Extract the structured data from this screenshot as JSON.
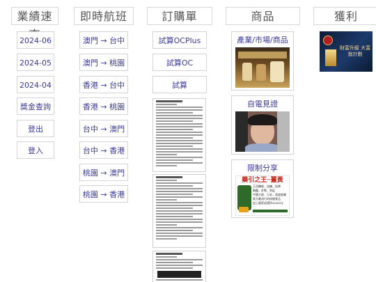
{
  "columns": {
    "performance": {
      "header": "業績速查",
      "items": [
        "2024-06",
        "2024-05",
        "2024-04",
        "獎金查詢",
        "登出",
        "登入"
      ]
    },
    "flights": {
      "header": "即時航班",
      "items": [
        "澳門 → 台中",
        "澳門 → 桃園",
        "香港 → 台中",
        "香港 → 桃園",
        "台中 → 澳門",
        "台中 → 香港",
        "桃園 → 澳門",
        "桃園 → 香港"
      ]
    },
    "orders": {
      "header": "訂購單",
      "items": [
        "試算OCPlus",
        "試算OC",
        "試算"
      ]
    },
    "products": {
      "header": "商品",
      "cards": [
        "產業/市場/商品",
        "自電見證",
        "限制分享"
      ],
      "promo_heading": "藥引之王─薑黃",
      "promo_lines": [
        "正冠纖維，血糖，肌膚",
        "胸腹，肝腎，免疫",
        "中國大陸、日本，高度推薦",
        "東方最流行的保健食品",
        "加上國家認證Discovery"
      ]
    },
    "profit": {
      "header": "獲利",
      "banner_text": "財富升級 大富翁計劃"
    }
  }
}
